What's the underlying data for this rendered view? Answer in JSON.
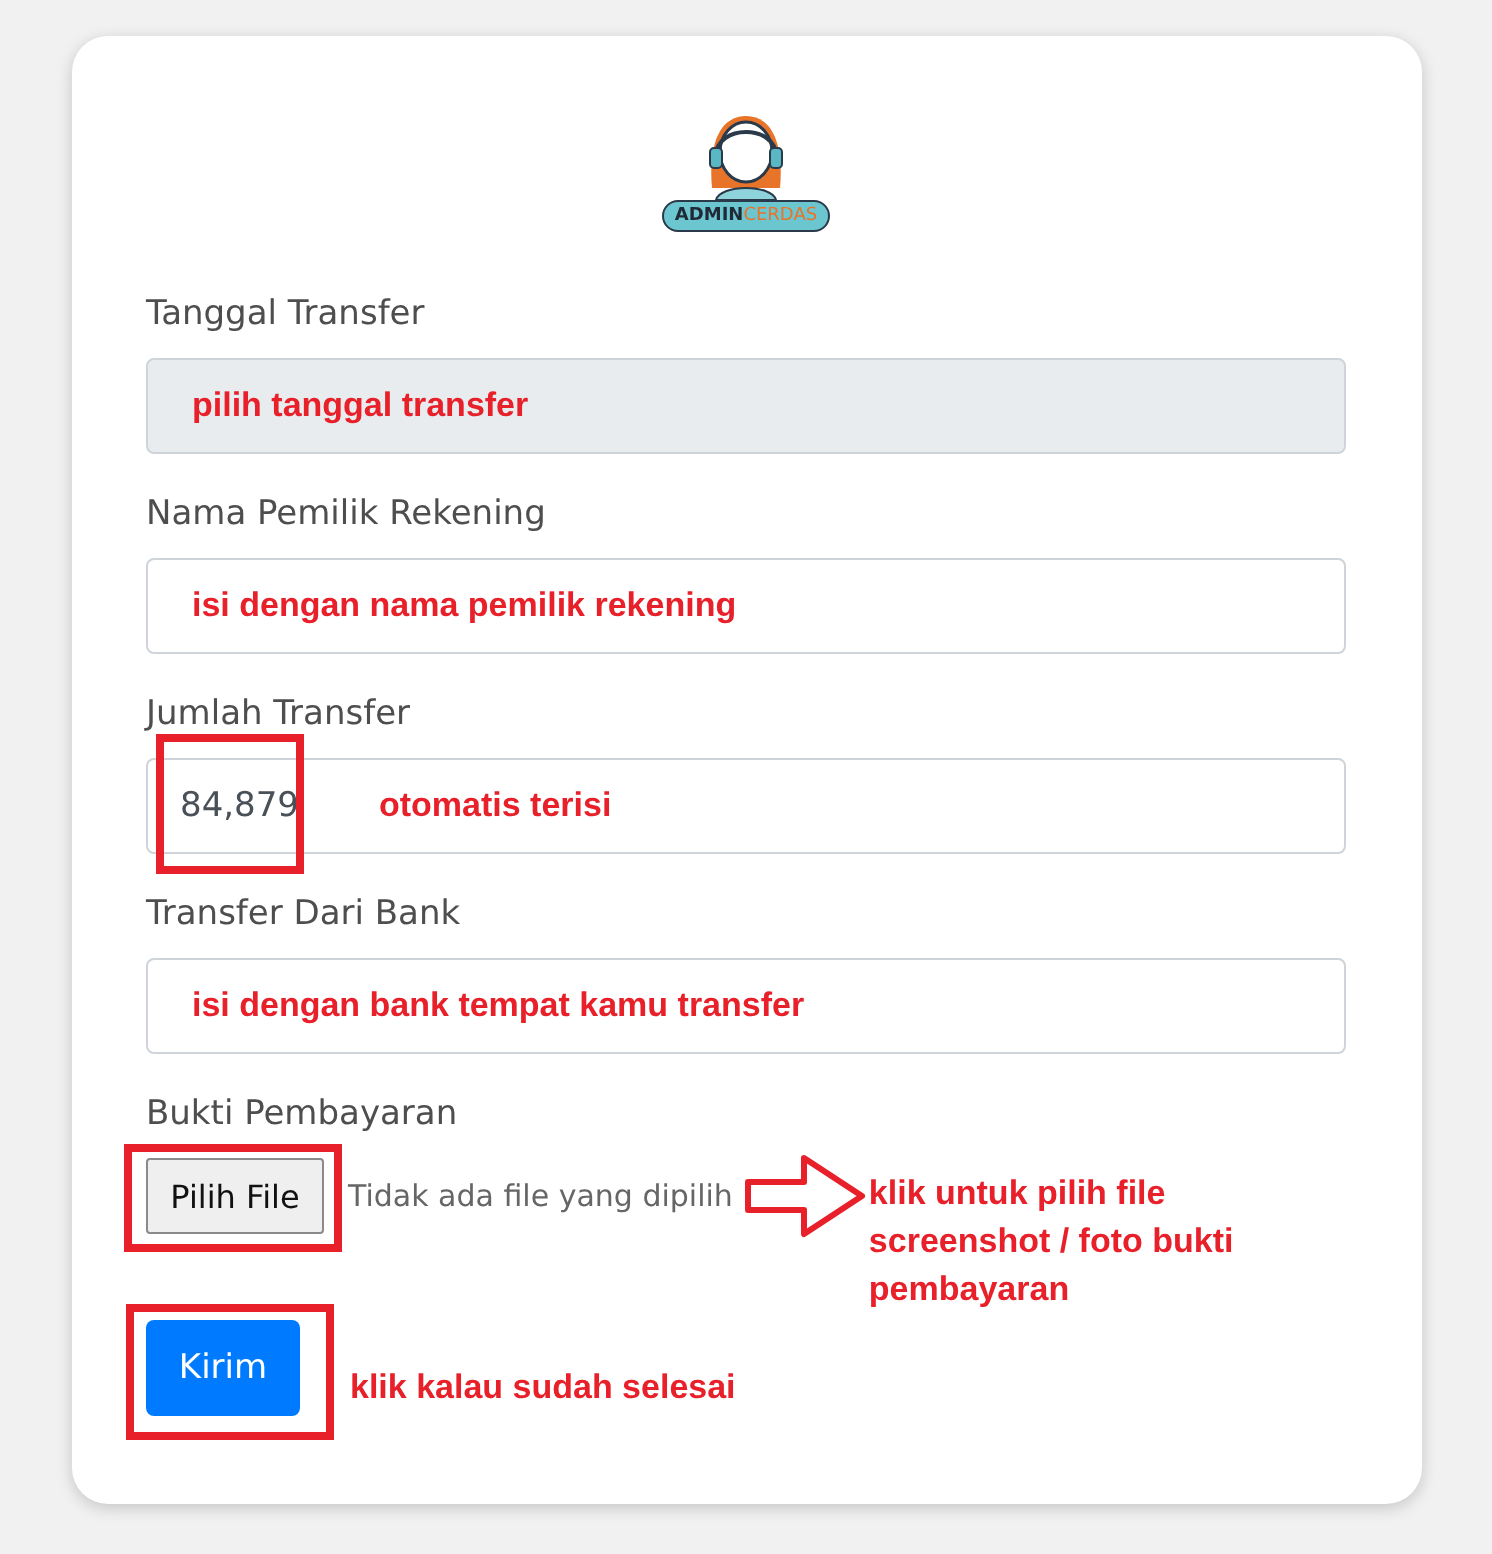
{
  "logo": {
    "first": "ADMIN",
    "second": "CERDAS"
  },
  "fields": [
    {
      "label": "Tanggal Transfer",
      "readonly": true,
      "note": "pilih tanggal transfer"
    },
    {
      "label": "Nama Pemilik Rekening",
      "readonly": false,
      "note": "isi dengan nama pemilik rekening"
    },
    {
      "label": "Jumlah Transfer",
      "readonly": false,
      "value": "84,879",
      "highlighted": true,
      "note": "otomatis terisi"
    },
    {
      "label": "Transfer Dari Bank",
      "readonly": false,
      "note": "isi dengan bank tempat kamu transfer"
    }
  ],
  "upload": {
    "label": "Bukti Pembayaran",
    "button": "Pilih File",
    "status": "Tidak ada file yang dipilih",
    "highlighted": true,
    "note": "klik untuk pilih file screenshot / foto bukti pembayaran"
  },
  "submit": {
    "label": "Kirim",
    "highlighted": true,
    "note": "klik kalau sudah selesai"
  }
}
